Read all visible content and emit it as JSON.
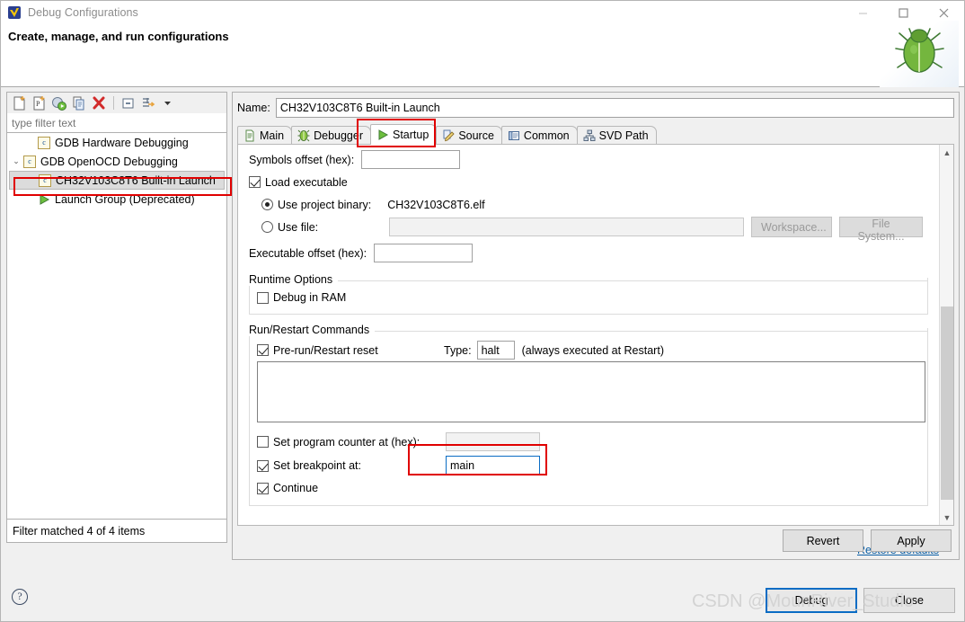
{
  "window": {
    "title": "Debug Configurations",
    "icon": "eclipse-icon",
    "minimize": "—",
    "maximize": "□",
    "close": "✕"
  },
  "header": {
    "title": "Create, manage, and run configurations",
    "decoration_icon": "green-bug-icon"
  },
  "toolbar": {
    "items": [
      {
        "name": "new-launch-configuration-icon",
        "glyph": "new-doc"
      },
      {
        "name": "new-prototype-icon",
        "glyph": "new-proto"
      },
      {
        "name": "export-icon",
        "glyph": "export"
      },
      {
        "name": "duplicate-icon",
        "glyph": "duplicate"
      },
      {
        "name": "delete-icon",
        "glyph": "delete"
      },
      {
        "name": "collapse-all-icon",
        "glyph": "collapse"
      },
      {
        "name": "filter-launch-configurations-icon",
        "glyph": "filter"
      },
      {
        "name": "view-menu-icon",
        "glyph": "chevron-down"
      }
    ]
  },
  "filter": {
    "placeholder": "type filter text",
    "value": ""
  },
  "tree": {
    "items": [
      {
        "label": "GDB Hardware Debugging",
        "icon": "c-config-icon",
        "indent": 1,
        "expander": "",
        "selected": false
      },
      {
        "label": "GDB OpenOCD Debugging",
        "icon": "c-config-icon",
        "indent": 0,
        "expander": "⌄",
        "selected": false
      },
      {
        "label": "CH32V103C8T6 Built-in Launch",
        "icon": "c-config-icon",
        "indent": 2,
        "expander": "",
        "selected": true
      },
      {
        "label": "Launch Group (Deprecated)",
        "icon": "play-icon",
        "indent": 1,
        "expander": "",
        "selected": false
      }
    ]
  },
  "status": {
    "filter_text": "Filter matched 4 of 4 items"
  },
  "config": {
    "name_label": "Name:",
    "name_value": "CH32V103C8T6 Built-in Launch"
  },
  "tabs": [
    {
      "label": "Main",
      "icon": "main-tab-icon",
      "active": false
    },
    {
      "label": "Debugger",
      "icon": "debugger-tab-icon",
      "active": false
    },
    {
      "label": "Startup",
      "icon": "startup-tab-icon",
      "active": true
    },
    {
      "label": "Source",
      "icon": "source-tab-icon",
      "active": false
    },
    {
      "label": "Common",
      "icon": "common-tab-icon",
      "active": false
    },
    {
      "label": "SVD Path",
      "icon": "svd-path-tab-icon",
      "active": false
    }
  ],
  "startup": {
    "symbols_offset_label": "Symbols offset (hex):",
    "symbols_offset_value": "",
    "load_executable_label": "Load executable",
    "load_executable_checked": true,
    "use_project_binary_label": "Use project binary:",
    "use_project_binary_selected": true,
    "project_binary_value": "CH32V103C8T6.elf",
    "use_file_label": "Use file:",
    "use_file_selected": false,
    "use_file_value": "",
    "workspace_button": "Workspace...",
    "file_system_button": "File System...",
    "executable_offset_label": "Executable offset (hex):",
    "executable_offset_value": "",
    "runtime_options_title": "Runtime Options",
    "debug_in_ram_label": "Debug in RAM",
    "debug_in_ram_checked": false,
    "run_restart_title": "Run/Restart Commands",
    "prerun_reset_label": "Pre-run/Restart reset",
    "prerun_reset_checked": true,
    "type_label": "Type:",
    "type_value": "halt",
    "type_note": "(always executed at Restart)",
    "commands_value": "",
    "set_pc_label": "Set program counter at (hex):",
    "set_pc_checked": false,
    "set_pc_value": "",
    "set_breakpoint_label": "Set breakpoint at:",
    "set_breakpoint_checked": true,
    "set_breakpoint_value": "main",
    "continue_label": "Continue",
    "continue_checked": true,
    "restore_defaults": "Restore defaults"
  },
  "actions": {
    "revert": "Revert",
    "apply": "Apply",
    "debug": "Debug",
    "close": "Close",
    "help": "?"
  },
  "watermark": "CSDN @MounRiver_Studio",
  "colors": {
    "accent_blue": "#0a6cc4",
    "link_blue": "#0b5fa5",
    "annotation_red": "#e00000",
    "selection_gray": "#dcdcdc"
  }
}
